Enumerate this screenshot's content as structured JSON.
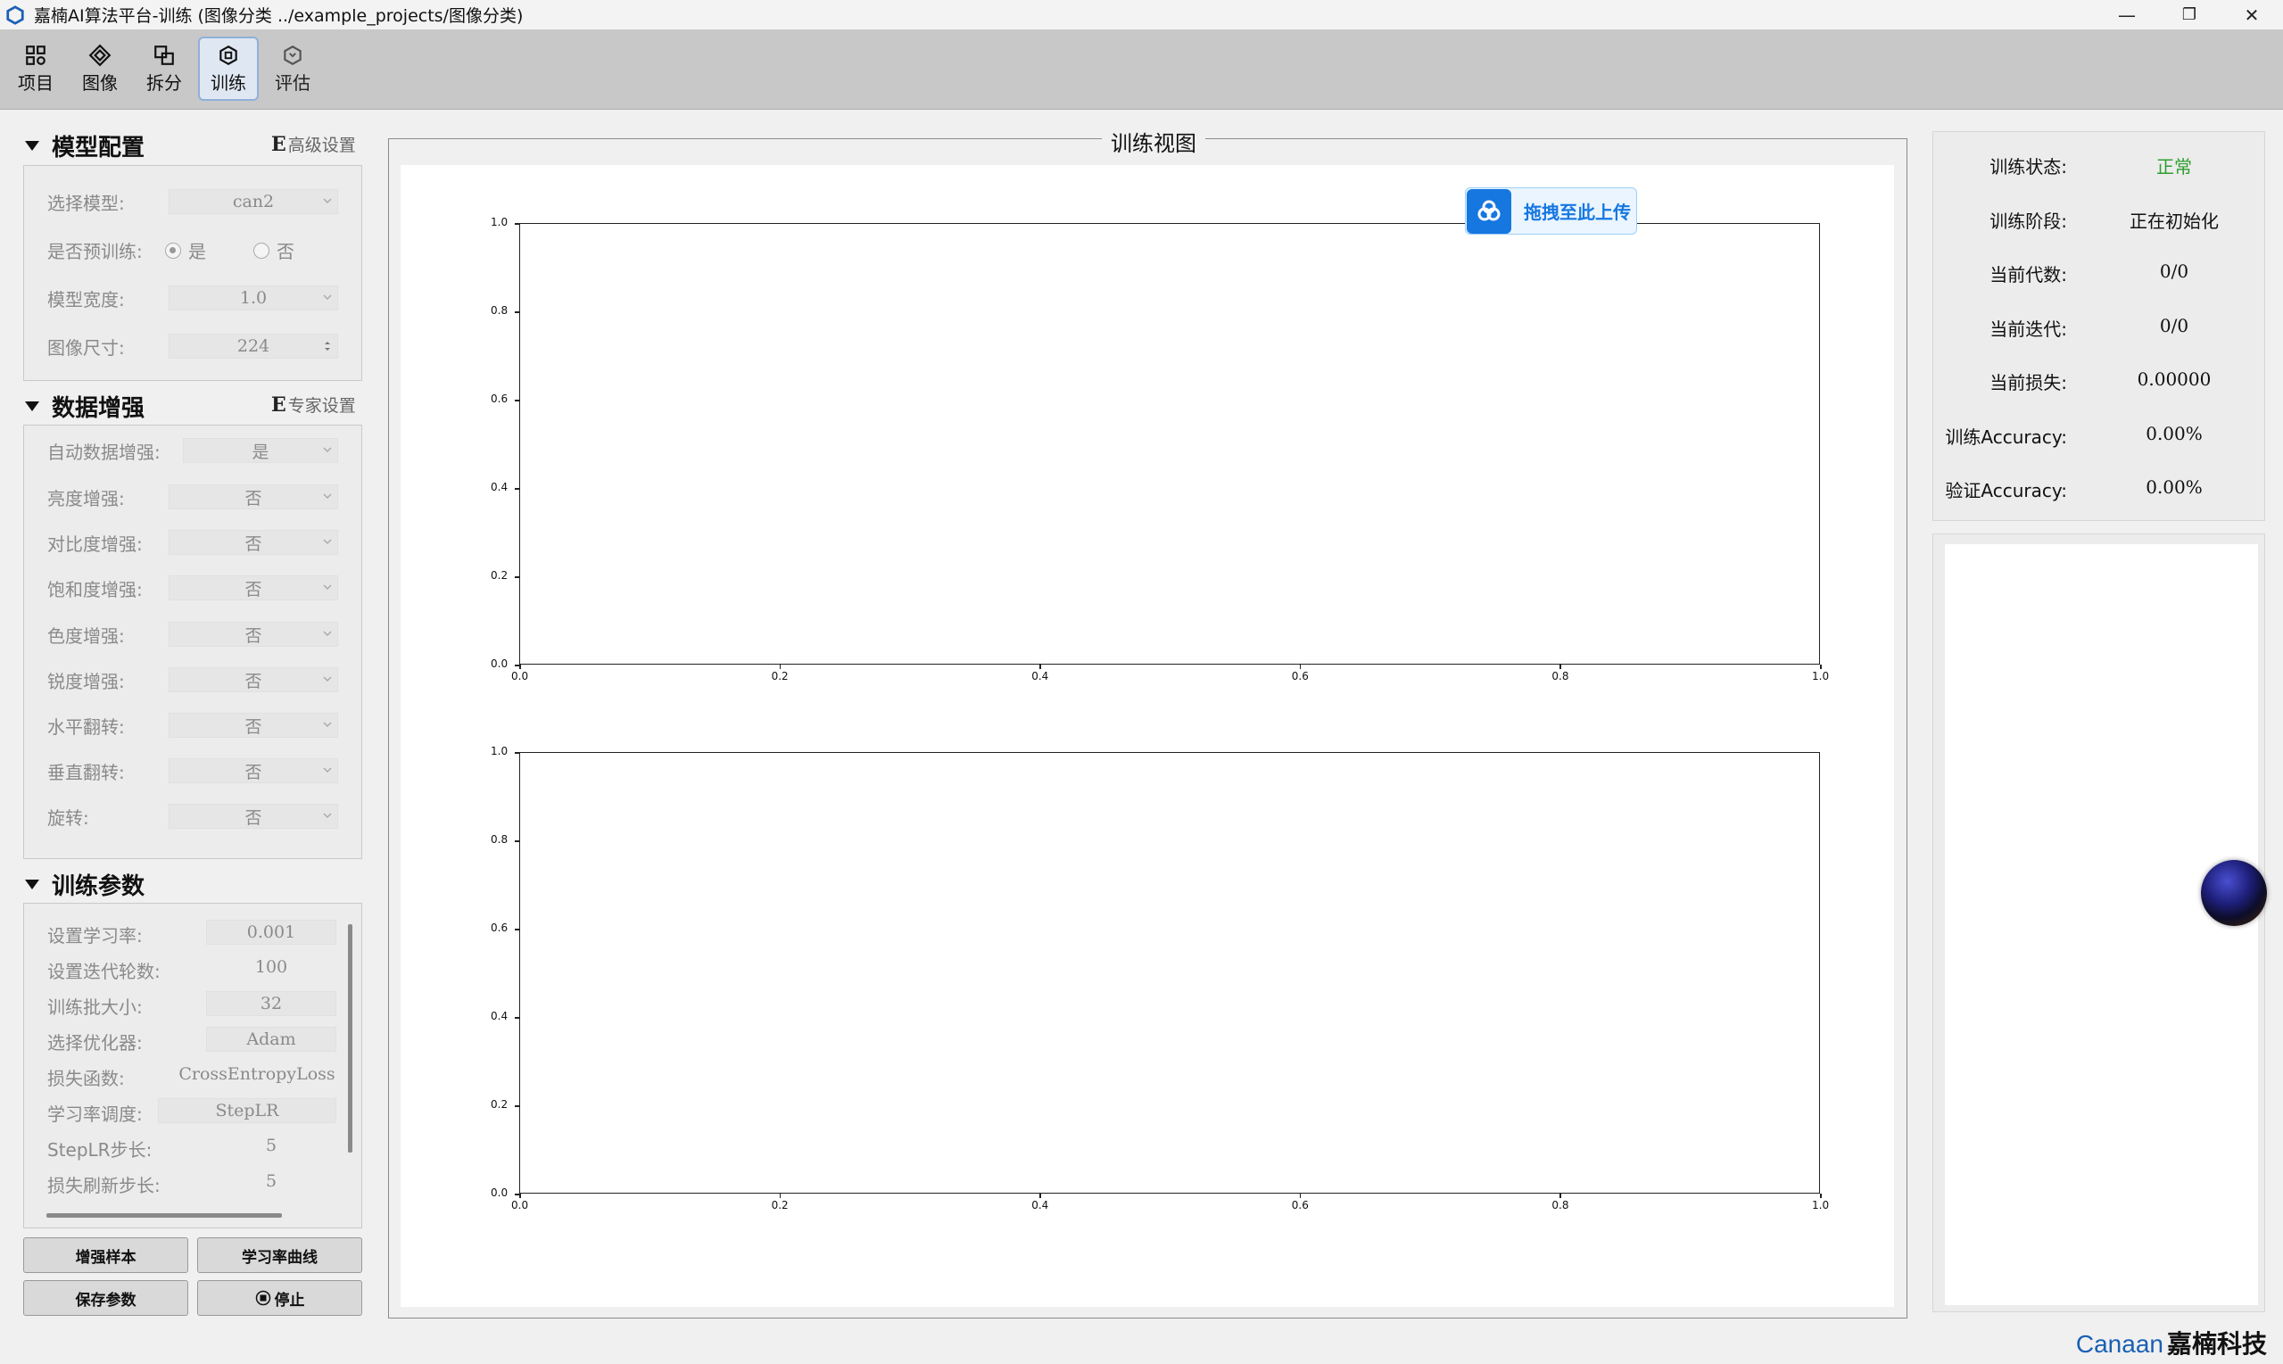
{
  "window": {
    "title": "嘉楠AI算法平台-训练 (图像分类  ../example_projects/图像分类)",
    "minimize": "—",
    "maximize": "❐",
    "close": "✕"
  },
  "toolbar": [
    {
      "label": "项目",
      "icon": "project-icon"
    },
    {
      "label": "图像",
      "icon": "image-icon"
    },
    {
      "label": "拆分",
      "icon": "split-icon"
    },
    {
      "label": "训练",
      "icon": "train-icon"
    },
    {
      "label": "评估",
      "icon": "evaluate-icon"
    }
  ],
  "model_config": {
    "title": "模型配置",
    "advanced_letter": "E",
    "advanced_label": "高级设置",
    "rows": [
      {
        "label": "选择模型:",
        "value": "can2"
      },
      {
        "label": "是否预训练:",
        "radio_yes": "是",
        "radio_no": "否"
      },
      {
        "label": "模型宽度:",
        "value": "1.0"
      },
      {
        "label": "图像尺寸:",
        "value": "224"
      }
    ]
  },
  "augment": {
    "title": "数据增强",
    "expert_letter": "E",
    "expert_label": "专家设置",
    "rows": [
      {
        "label": "自动数据增强:",
        "value": "是"
      },
      {
        "label": "亮度增强:",
        "value": "否"
      },
      {
        "label": "对比度增强:",
        "value": "否"
      },
      {
        "label": "饱和度增强:",
        "value": "否"
      },
      {
        "label": "色度增强:",
        "value": "否"
      },
      {
        "label": "锐度增强:",
        "value": "否"
      },
      {
        "label": "水平翻转:",
        "value": "否"
      },
      {
        "label": "垂直翻转:",
        "value": "否"
      },
      {
        "label": "旋转:",
        "value": "否"
      }
    ]
  },
  "train_params": {
    "title": "训练参数",
    "rows": [
      {
        "label": "设置学习率:",
        "value": "0.001"
      },
      {
        "label": "设置迭代轮数:",
        "value": "100"
      },
      {
        "label": "训练批大小:",
        "value": "32"
      },
      {
        "label": "选择优化器:",
        "value": "Adam"
      },
      {
        "label": "损失函数:",
        "value": "CrossEntropyLoss"
      },
      {
        "label": "学习率调度:",
        "value": "StepLR"
      },
      {
        "label": "StepLR步长:",
        "value": "5"
      },
      {
        "label": "损失刷新步长:",
        "value": "5"
      }
    ]
  },
  "buttons": {
    "augment_samples": "增强样本",
    "lr_curve": "学习率曲线",
    "save_params": "保存参数",
    "stop": "停止"
  },
  "center": {
    "title": "训练视图",
    "upload_label": "拖拽至此上传"
  },
  "chart_data": [
    {
      "type": "line",
      "series": [],
      "xlim": [
        0.0,
        1.0
      ],
      "ylim": [
        0.0,
        1.0
      ],
      "xticks": [
        "0.0",
        "0.2",
        "0.4",
        "0.6",
        "0.8",
        "1.0"
      ],
      "yticks": [
        "0.0",
        "0.2",
        "0.4",
        "0.6",
        "0.8",
        "1.0"
      ]
    },
    {
      "type": "line",
      "series": [],
      "xlim": [
        0.0,
        1.0
      ],
      "ylim": [
        0.0,
        1.0
      ],
      "xticks": [
        "0.0",
        "0.2",
        "0.4",
        "0.6",
        "0.8",
        "1.0"
      ],
      "yticks": [
        "0.0",
        "0.2",
        "0.4",
        "0.6",
        "0.8",
        "1.0"
      ]
    }
  ],
  "status": {
    "rows": [
      {
        "label": "训练状态:",
        "value": "正常"
      },
      {
        "label": "训练阶段:",
        "value": "正在初始化"
      },
      {
        "label": "当前代数:",
        "value": "0/0"
      },
      {
        "label": "当前迭代:",
        "value": "0/0"
      },
      {
        "label": "当前损失:",
        "value": "0.00000"
      },
      {
        "label": "训练Accuracy:",
        "value": "0.00%"
      },
      {
        "label": "验证Accuracy:",
        "value": "0.00%"
      }
    ],
    "ok_color": "#2e9e2e"
  },
  "brand": {
    "en": "Canaan",
    "cn": "嘉楠科技"
  }
}
